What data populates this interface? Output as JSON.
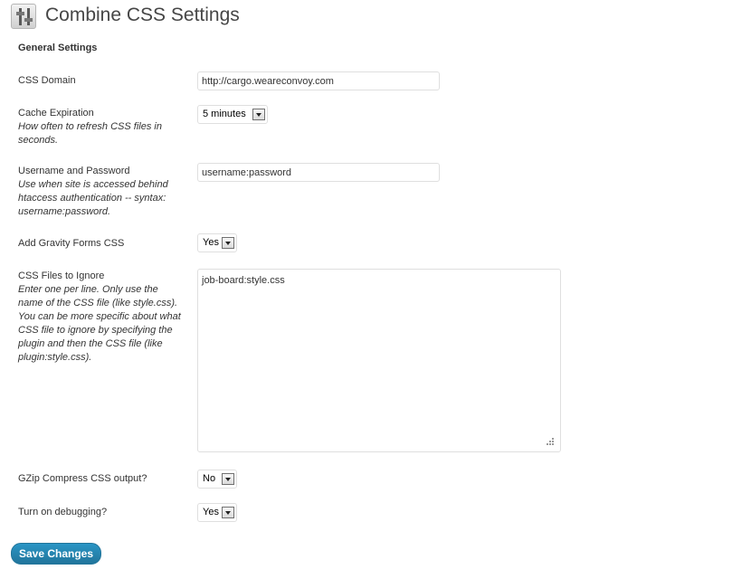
{
  "header": {
    "title": "Combine CSS Settings",
    "icon": "settings-sliders-icon"
  },
  "section": {
    "title": "General Settings"
  },
  "fields": {
    "css_domain": {
      "label": "CSS Domain",
      "value": "http://cargo.weareconvoy.com"
    },
    "cache_expiration": {
      "label": "Cache Expiration",
      "description": "How often to refresh CSS files in seconds.",
      "selected": "5 minutes"
    },
    "username_password": {
      "label": "Username and Password",
      "description": "Use when site is accessed behind htaccess authentication -- syntax: username:password.",
      "value": "username:password"
    },
    "gravity_forms": {
      "label": "Add Gravity Forms CSS",
      "selected": "Yes"
    },
    "files_ignore": {
      "label": "CSS Files to Ignore",
      "description": "Enter one per line. Only use the name of the CSS file (like style.css). You can be more specific about what CSS file to ignore by specifying the plugin and then the CSS file (like plugin:style.css).",
      "value": "job-board:style.css"
    },
    "gzip": {
      "label": "GZip Compress CSS output?",
      "selected": "No"
    },
    "debugging": {
      "label": "Turn on debugging?",
      "selected": "Yes"
    }
  },
  "actions": {
    "save_label": "Save Changes"
  },
  "colors": {
    "primary_button": "#21759b",
    "input_border": "#dfdfdf"
  }
}
